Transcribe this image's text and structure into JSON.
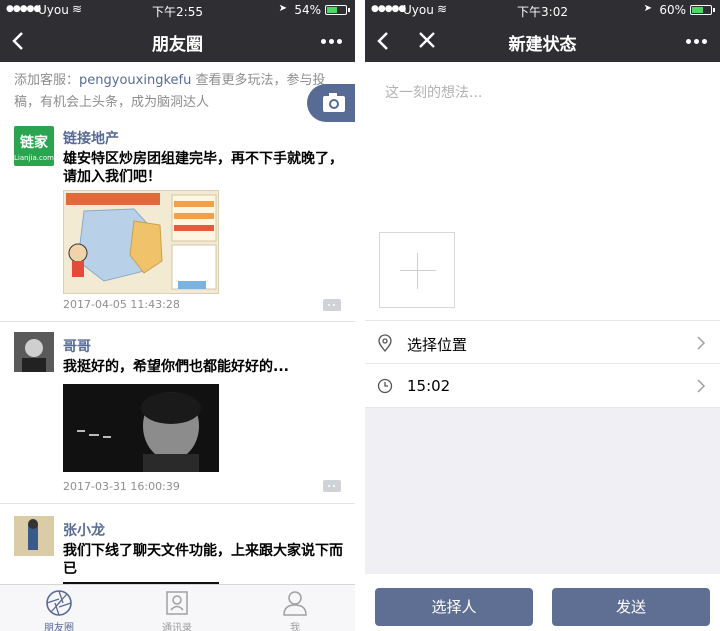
{
  "left": {
    "status": {
      "carrier": "Uyou",
      "time": "下午2:55",
      "battery": "54%",
      "battery_fill": 0.54
    },
    "nav": {
      "title": "朋友圈"
    },
    "notice": {
      "prefix": "添加客服：",
      "account": "pengyouxingkefu",
      "suffix": " 查看更多玩法，参与投稿，有机会上头条，成为脑洞达人"
    },
    "posts": [
      {
        "name": "链接地产",
        "text": "雄安特区炒房团组建完毕，再不下手就晚了，请加入我们吧！",
        "time": "2017-04-05 11:43:28",
        "avatar_text": "链家",
        "avatar_sub": "Lianjia.com"
      },
      {
        "name": "哥哥",
        "text": "我挺好的，希望你們也都能好好的...",
        "time": "2017-03-31 16:00:39"
      },
      {
        "name": "张小龙",
        "text": "我们下线了聊天文件功能，上来跟大家说下而已"
      }
    ],
    "tabs": [
      {
        "label": "朋友圈",
        "icon": "aperture-icon",
        "active": true
      },
      {
        "label": "通讯录",
        "icon": "contacts-icon",
        "active": false
      },
      {
        "label": "我",
        "icon": "person-icon",
        "active": false
      }
    ]
  },
  "right": {
    "status": {
      "carrier": "Uyou",
      "time": "下午3:02",
      "battery": "60%",
      "battery_fill": 0.6
    },
    "nav": {
      "title": "新建状态"
    },
    "compose": {
      "placeholder": "这一刻的想法..."
    },
    "rows": {
      "location": "选择位置",
      "time": "15:02"
    },
    "buttons": {
      "choose": "选择人",
      "send": "发送"
    }
  },
  "colors": {
    "bar": "#2e2e33",
    "link": "#576b95",
    "button": "#5f6e93",
    "wechat_green": "#2aa44f"
  }
}
